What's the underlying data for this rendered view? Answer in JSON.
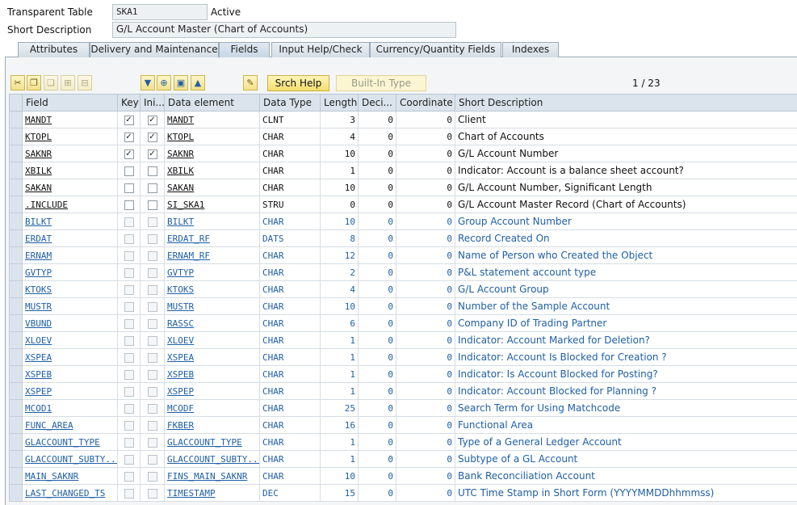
{
  "header": {
    "table_label": "Transparent Table",
    "table_name": "SKA1",
    "status": "Active",
    "desc_label": "Short Description",
    "desc_value": "G/L Account Master (Chart of Accounts)"
  },
  "tabs": [
    {
      "label": "Attributes"
    },
    {
      "label": "Delivery and Maintenance"
    },
    {
      "label": "Fields"
    },
    {
      "label": "Input Help/Check"
    },
    {
      "label": "Currency/Quantity Fields"
    },
    {
      "label": "Indexes"
    }
  ],
  "toolbar": {
    "srch_help": "Srch Help",
    "built_in_type": "Built-In Type",
    "pager": "1 / 23",
    "icons": [
      "cut-icon",
      "copy-icon",
      "paste-icon",
      "insert-row-icon",
      "delete-row-icon",
      "find-icon",
      "new-field-icon",
      "structure-icon",
      "top-icon",
      "where-used-icon"
    ]
  },
  "columns": [
    "Field",
    "Key",
    "Ini...",
    "Data element",
    "Data Type",
    "Length",
    "Deci...",
    "Coordinate",
    "Short Description"
  ],
  "rows": [
    {
      "field": "MANDT",
      "key": true,
      "ini": true,
      "elem": "MANDT",
      "type": "CLNT",
      "len": "3",
      "dec": "0",
      "coord": "0",
      "desc": "Client",
      "blue": false
    },
    {
      "field": "KTOPL",
      "key": true,
      "ini": true,
      "elem": "KTOPL",
      "type": "CHAR",
      "len": "4",
      "dec": "0",
      "coord": "0",
      "desc": "Chart of Accounts",
      "blue": false
    },
    {
      "field": "SAKNR",
      "key": true,
      "ini": true,
      "elem": "SAKNR",
      "type": "CHAR",
      "len": "10",
      "dec": "0",
      "coord": "0",
      "desc": "G/L Account Number",
      "blue": false
    },
    {
      "field": "XBILK",
      "key": false,
      "ini": false,
      "elem": "XBILK",
      "type": "CHAR",
      "len": "1",
      "dec": "0",
      "coord": "0",
      "desc": "Indicator: Account is a balance sheet account?",
      "blue": false
    },
    {
      "field": "SAKAN",
      "key": false,
      "ini": false,
      "elem": "SAKAN",
      "type": "CHAR",
      "len": "10",
      "dec": "0",
      "coord": "0",
      "desc": "G/L Account Number, Significant Length",
      "blue": false
    },
    {
      "field": ".INCLUDE",
      "key": false,
      "ini": false,
      "elem": "SI_SKA1",
      "type": "STRU",
      "len": "0",
      "dec": "0",
      "coord": "0",
      "desc": "G/L Account Master Record (Chart of Accounts)",
      "blue": false
    },
    {
      "field": "BILKT",
      "key": false,
      "ini": false,
      "elem": "BILKT",
      "type": "CHAR",
      "len": "10",
      "dec": "0",
      "coord": "0",
      "desc": "Group Account Number",
      "blue": true
    },
    {
      "field": "ERDAT",
      "key": false,
      "ini": false,
      "elem": "ERDAT_RF",
      "type": "DATS",
      "len": "8",
      "dec": "0",
      "coord": "0",
      "desc": "Record Created On",
      "blue": true
    },
    {
      "field": "ERNAM",
      "key": false,
      "ini": false,
      "elem": "ERNAM_RF",
      "type": "CHAR",
      "len": "12",
      "dec": "0",
      "coord": "0",
      "desc": "Name of Person who Created the Object",
      "blue": true
    },
    {
      "field": "GVTYP",
      "key": false,
      "ini": false,
      "elem": "GVTYP",
      "type": "CHAR",
      "len": "2",
      "dec": "0",
      "coord": "0",
      "desc": "P&L statement account type",
      "blue": true
    },
    {
      "field": "KTOKS",
      "key": false,
      "ini": false,
      "elem": "KTOKS",
      "type": "CHAR",
      "len": "4",
      "dec": "0",
      "coord": "0",
      "desc": "G/L Account Group",
      "blue": true
    },
    {
      "field": "MUSTR",
      "key": false,
      "ini": false,
      "elem": "MUSTR",
      "type": "CHAR",
      "len": "10",
      "dec": "0",
      "coord": "0",
      "desc": "Number of the Sample Account",
      "blue": true
    },
    {
      "field": "VBUND",
      "key": false,
      "ini": false,
      "elem": "RASSC",
      "type": "CHAR",
      "len": "6",
      "dec": "0",
      "coord": "0",
      "desc": "Company ID of Trading Partner",
      "blue": true
    },
    {
      "field": "XLOEV",
      "key": false,
      "ini": false,
      "elem": "XLOEV",
      "type": "CHAR",
      "len": "1",
      "dec": "0",
      "coord": "0",
      "desc": "Indicator: Account Marked for Deletion?",
      "blue": true
    },
    {
      "field": "XSPEA",
      "key": false,
      "ini": false,
      "elem": "XSPEA",
      "type": "CHAR",
      "len": "1",
      "dec": "0",
      "coord": "0",
      "desc": "Indicator: Account Is Blocked for Creation ?",
      "blue": true
    },
    {
      "field": "XSPEB",
      "key": false,
      "ini": false,
      "elem": "XSPEB",
      "type": "CHAR",
      "len": "1",
      "dec": "0",
      "coord": "0",
      "desc": "Indicator: Is Account Blocked for Posting?",
      "blue": true
    },
    {
      "field": "XSPEP",
      "key": false,
      "ini": false,
      "elem": "XSPEP",
      "type": "CHAR",
      "len": "1",
      "dec": "0",
      "coord": "0",
      "desc": "Indicator: Account Blocked for Planning ?",
      "blue": true
    },
    {
      "field": "MCOD1",
      "key": false,
      "ini": false,
      "elem": "MCODF",
      "type": "CHAR",
      "len": "25",
      "dec": "0",
      "coord": "0",
      "desc": "Search Term for Using Matchcode",
      "blue": true
    },
    {
      "field": "FUNC_AREA",
      "key": false,
      "ini": false,
      "elem": "FKBER",
      "type": "CHAR",
      "len": "16",
      "dec": "0",
      "coord": "0",
      "desc": "Functional Area",
      "blue": true
    },
    {
      "field": "GLACCOUNT_TYPE",
      "key": false,
      "ini": false,
      "elem": "GLACCOUNT_TYPE",
      "type": "CHAR",
      "len": "1",
      "dec": "0",
      "coord": "0",
      "desc": "Type of a General Ledger Account",
      "blue": true
    },
    {
      "field": "GLACCOUNT_SUBTY...",
      "key": false,
      "ini": false,
      "elem": "GLACCOUNT_SUBTY...",
      "type": "CHAR",
      "len": "1",
      "dec": "0",
      "coord": "0",
      "desc": "Subtype of a GL Account",
      "blue": true
    },
    {
      "field": "MAIN_SAKNR",
      "key": false,
      "ini": false,
      "elem": "FINS_MAIN_SAKNR",
      "type": "CHAR",
      "len": "10",
      "dec": "0",
      "coord": "0",
      "desc": "Bank Reconciliation Account",
      "blue": true
    },
    {
      "field": "LAST_CHANGED_TS",
      "key": false,
      "ini": false,
      "elem": "TIMESTAMP",
      "type": "DEC",
      "len": "15",
      "dec": "0",
      "coord": "0",
      "desc": "UTC Time Stamp in Short Form (YYYYMMDDhhmmss)",
      "blue": true
    }
  ]
}
